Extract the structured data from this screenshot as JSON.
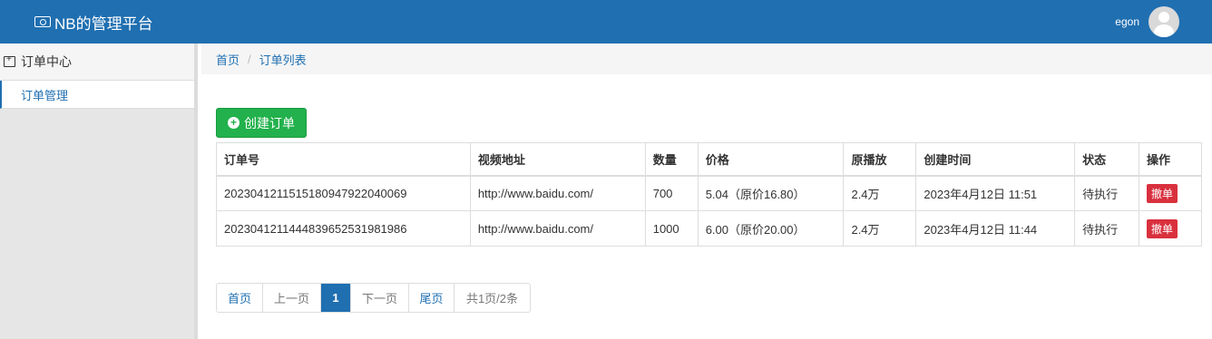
{
  "header": {
    "title": "NB的管理平台",
    "brand_icon": "money-icon",
    "username": "egon"
  },
  "sidebar": {
    "group_label": "订单中心",
    "group_icon": "calendar-plus-icon",
    "items": [
      {
        "label": "订单管理",
        "active": true
      }
    ]
  },
  "breadcrumb": {
    "home": "首页",
    "current": "订单列表",
    "separator": "/"
  },
  "toolbar": {
    "create_label": "创建订单"
  },
  "table": {
    "columns": [
      "订单号",
      "视频地址",
      "数量",
      "价格",
      "原播放",
      "创建时间",
      "状态",
      "操作"
    ],
    "rows": [
      {
        "order_no": "20230412115151809479220400​69",
        "url": "http://www.baidu.com/",
        "quantity": "700",
        "price": "5.04（原价16.80）",
        "original_plays": "2.4万",
        "created": "2023年4月12日 11:51",
        "status": "待执行",
        "action": "撤单"
      },
      {
        "order_no": "20230412114448396525319819​86",
        "url": "http://www.baidu.com/",
        "quantity": "1000",
        "price": "6.00（原价20.00）",
        "original_plays": "2.4万",
        "created": "2023年4月12日 11:44",
        "status": "待执行",
        "action": "撤单"
      }
    ]
  },
  "pagination": {
    "first": "首页",
    "prev": "上一页",
    "current": "1",
    "next": "下一页",
    "last": "尾页",
    "summary": "共1页/2条"
  },
  "colors": {
    "primary": "#1f6fb1",
    "success": "#22b14c",
    "danger": "#d9303e"
  }
}
